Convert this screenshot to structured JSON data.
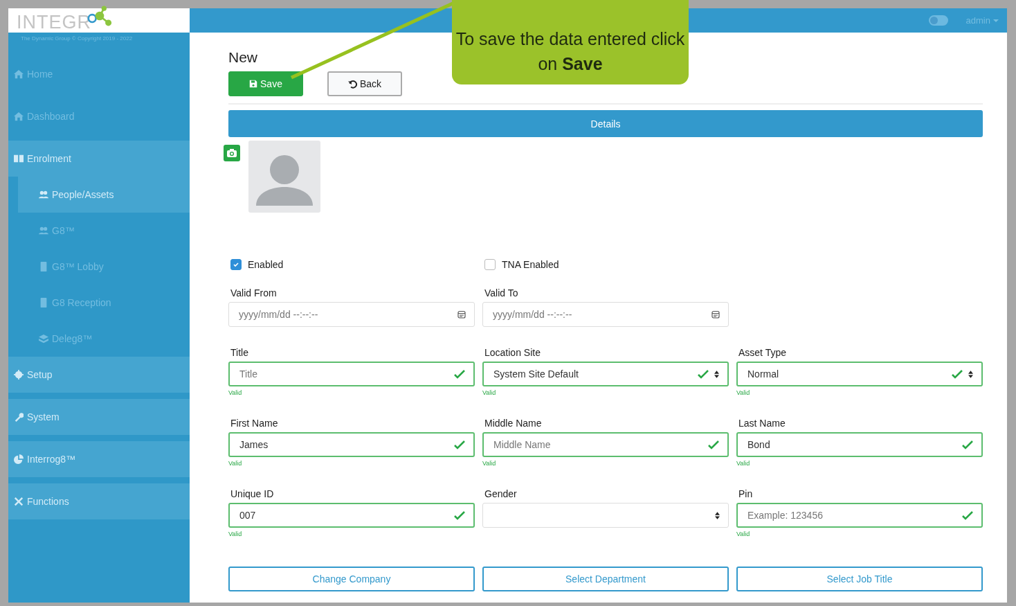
{
  "brand": {
    "logo": "INTEGR",
    "copyright": "The Dynamic Group © Copyright 2019 - 2022"
  },
  "sidebar": {
    "items": [
      {
        "label": "Home",
        "kind": "link"
      },
      {
        "label": "Dashboard",
        "kind": "link"
      },
      {
        "label": "Enrolment",
        "kind": "group",
        "expanded": true,
        "children": [
          {
            "label": "People/Assets",
            "selected": true
          },
          {
            "label": "G8™",
            "selected": false
          },
          {
            "label": "G8™ Lobby",
            "selected": false
          },
          {
            "label": "G8 Reception",
            "selected": false
          },
          {
            "label": "Deleg8™",
            "selected": false
          }
        ]
      },
      {
        "label": "Setup",
        "kind": "group",
        "expanded": false
      },
      {
        "label": "System",
        "kind": "group",
        "expanded": false
      },
      {
        "label": "Interrog8™",
        "kind": "group",
        "expanded": false
      },
      {
        "label": "Functions",
        "kind": "group",
        "expanded": false
      }
    ]
  },
  "topbar": {
    "toggle_on": false,
    "user": "admin"
  },
  "page": {
    "title": "New",
    "save": "Save",
    "back": "Back",
    "section": "Details"
  },
  "checks": [
    {
      "label": "Enabled",
      "checked": true
    },
    {
      "label": "TNA Enabled",
      "checked": false
    }
  ],
  "fields": [
    {
      "label": "Valid From",
      "kind": "datetime",
      "placeholder": "yyyy/mm/dd --:--:--",
      "valid": false
    },
    {
      "label": "Valid To",
      "kind": "datetime",
      "placeholder": "yyyy/mm/dd --:--:--",
      "valid": false
    },
    {
      "kind": "spacer"
    },
    {
      "label": "Title",
      "kind": "text",
      "placeholder": "Title",
      "valid": true,
      "note": "Valid"
    },
    {
      "label": "Location Site",
      "kind": "select",
      "value": "System Site Default",
      "valid": true,
      "note": "Valid"
    },
    {
      "label": "Asset Type",
      "kind": "select",
      "value": "Normal",
      "valid": true,
      "note": "Valid"
    },
    {
      "label": "First Name",
      "kind": "text",
      "value": "James",
      "valid": true,
      "note": "Valid"
    },
    {
      "label": "Middle Name",
      "kind": "text",
      "placeholder": "Middle Name",
      "valid": true,
      "note": "Valid"
    },
    {
      "label": "Last Name",
      "kind": "text",
      "value": "Bond",
      "valid": true,
      "note": "Valid"
    },
    {
      "label": "Unique ID",
      "kind": "text",
      "value": "007",
      "valid": true,
      "note": "Valid"
    },
    {
      "label": "Gender",
      "kind": "select",
      "valid": false
    },
    {
      "label": "Pin",
      "kind": "text",
      "placeholder": "Example: 123456",
      "valid": true,
      "note": "Valid"
    }
  ],
  "actions": [
    "Change Company",
    "Select Department",
    "Select Job Title"
  ],
  "callout": {
    "text": "To save the data entered click on **Save**"
  }
}
